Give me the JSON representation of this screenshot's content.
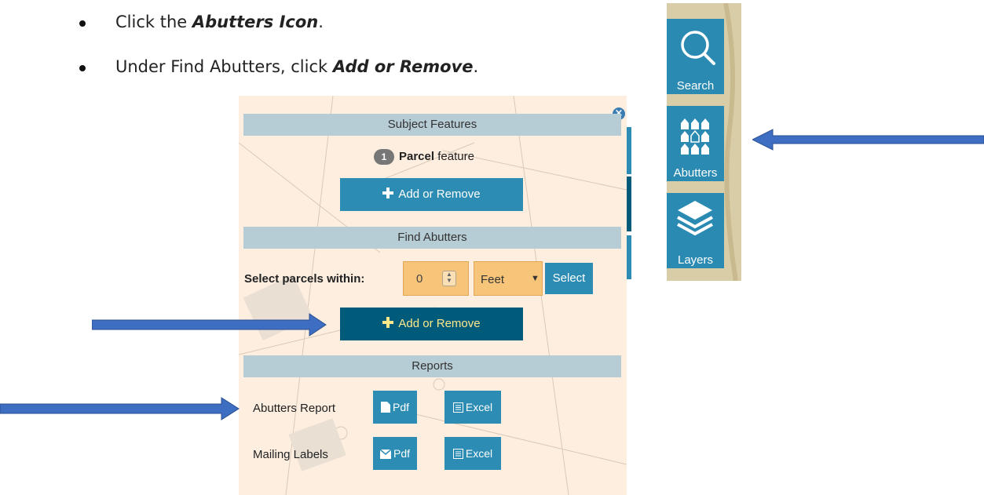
{
  "instructions": {
    "step1_prefix": "Click the ",
    "step1_emph": "Abutters Icon",
    "step1_suffix": ".",
    "step2_prefix": "Under Find Abutters, click ",
    "step2_emph": "Add or Remove",
    "step2_suffix": "."
  },
  "panel": {
    "close_label": "×",
    "subject_features": {
      "header": "Subject Features",
      "count": "1",
      "count_type": "Parcel",
      "count_suffix": "feature",
      "add_remove_label": "Add or Remove"
    },
    "find_abutters": {
      "header": "Find Abutters",
      "select_within_label": "Select parcels within:",
      "distance_value": "0",
      "unit_value": "Feet",
      "select_button": "Select",
      "add_remove_label": "Add or Remove"
    },
    "reports": {
      "header": "Reports",
      "rows": [
        {
          "label": "Abutters Report",
          "pdf": "Pdf",
          "excel": "Excel"
        },
        {
          "label": "Mailing Labels",
          "pdf": "Pdf",
          "excel": "Excel"
        }
      ]
    }
  },
  "toolbar": {
    "buttons": [
      {
        "label": "Search",
        "icon": "search-icon"
      },
      {
        "label": "Abutters",
        "icon": "abutters-icon"
      },
      {
        "label": "Layers",
        "icon": "layers-icon"
      }
    ]
  },
  "colors": {
    "button_blue": "#2c8cb4",
    "button_dark": "#005a7a",
    "section_header": "#b7cdd6",
    "panel_bg": "#fdeee0",
    "arrow": "#3e6ec2"
  }
}
